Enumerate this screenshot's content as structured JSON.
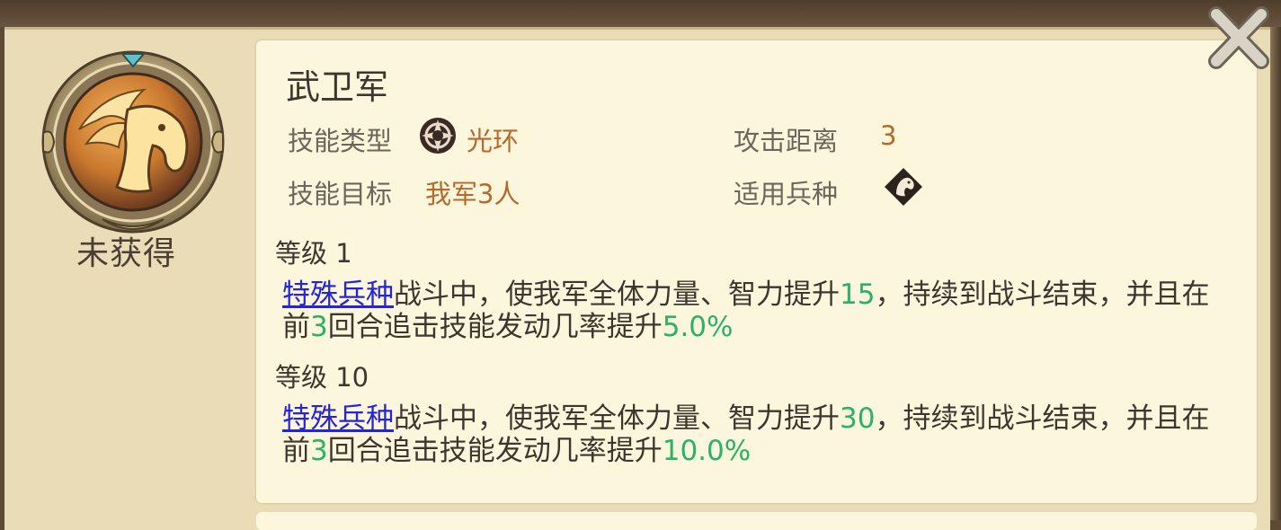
{
  "skill": {
    "name": "武卫军",
    "status": "未获得",
    "type_label": "技能类型",
    "type_value": "光环",
    "type_icon": "aura-icon",
    "target_label": "技能目标",
    "target_value": "我军3人",
    "range_label": "攻击距离",
    "range_value": "3",
    "troop_label": "适用兵种",
    "troop_icon": "cavalry-horse-icon"
  },
  "levels": [
    {
      "heading": "等级 1",
      "link": "特殊兵种",
      "text_1": "战斗中，使我军全体力量、智力提升",
      "num_1": "15",
      "text_2": "，持续到战斗结束，并且在前",
      "num_2": "3",
      "text_3": "回合追击技能发动几率提升",
      "num_3": "5.0%"
    },
    {
      "heading": "等级 10",
      "link": "特殊兵种",
      "text_1": "战斗中，使我军全体力量、智力提升",
      "num_1": "30",
      "text_2": "，持续到战斗结束，并且在前",
      "num_2": "3",
      "text_3": "回合追击技能发动几率提升",
      "num_3": "10.0%"
    }
  ],
  "colors": {
    "value_orange": "#b56a2b",
    "link_blue": "#2424d8",
    "number_green": "#2bb264",
    "card_bg": "#fcf6dc"
  },
  "icons": {
    "close": "close-icon",
    "medallion": "pegasus-medallion-icon"
  }
}
